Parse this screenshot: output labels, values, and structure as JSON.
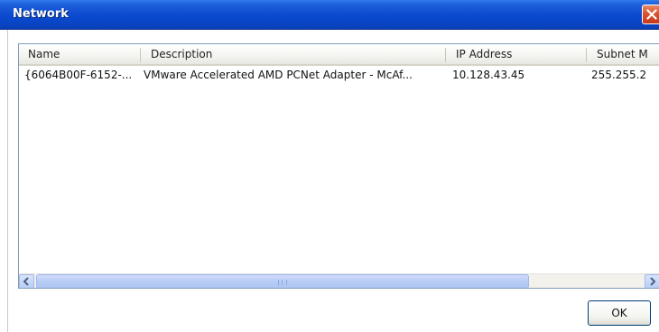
{
  "window": {
    "title": "Network"
  },
  "listview": {
    "columns": [
      "Name",
      "Description",
      "IP Address",
      "Subnet M"
    ],
    "rows": [
      {
        "name": "{6064B00F-6152-...",
        "description": "VMware Accelerated AMD PCNet Adapter - McAf...",
        "ip_address": "10.128.43.45",
        "subnet_mask": "255.255.2"
      }
    ]
  },
  "scrollbar": {
    "left_arrow_icon": "chevron-left-icon",
    "right_arrow_icon": "chevron-right-icon"
  },
  "footer": {
    "ok_label": "OK"
  },
  "colors": {
    "titlebar": "#0a49cf",
    "close_button": "#d9542d",
    "scrollbar": "#b9cff5"
  }
}
